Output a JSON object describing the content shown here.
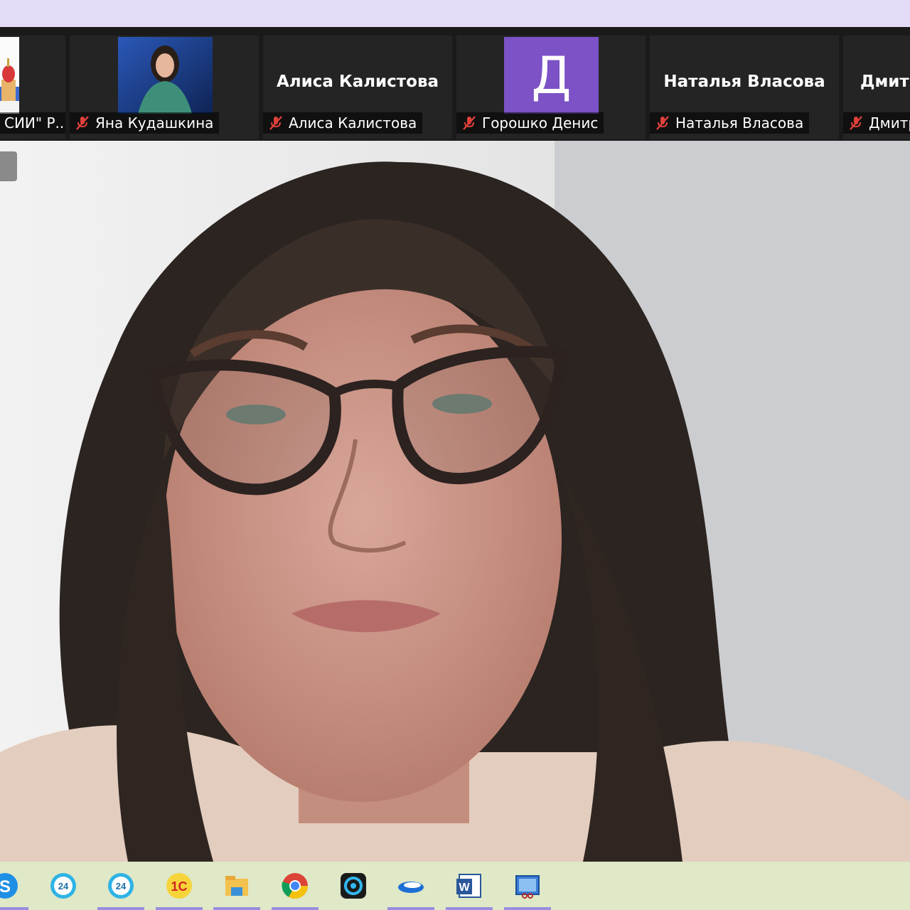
{
  "participants": [
    {
      "label": "СИИ\" Р..."
    },
    {
      "label": "Яна Кудашкина"
    },
    {
      "big": "Алиса Калистова",
      "label": "Алиса Калистова"
    },
    {
      "avatar_letter": "Д",
      "label": "Горошко Денис"
    },
    {
      "big": "Наталья Власова",
      "label": "Наталья Власова"
    },
    {
      "big": "Дмитр",
      "label": "Дмитр"
    }
  ],
  "colors": {
    "topbar": "#e4dcf7",
    "strip": "#1a1a1a",
    "avatar_purple": "#7c52c6",
    "taskbar": "#dfe8c7",
    "mute_red": "#e0413a"
  },
  "taskbar": {
    "items": [
      {
        "icon": "skype-icon"
      },
      {
        "icon": "bitrix24-icon"
      },
      {
        "icon": "bitrix24-icon"
      },
      {
        "icon": "1c-icon",
        "text": "1С"
      },
      {
        "icon": "file-explorer-icon"
      },
      {
        "icon": "chrome-icon"
      },
      {
        "icon": "camera-app-icon"
      },
      {
        "icon": "swirl-app-icon"
      },
      {
        "icon": "word-icon",
        "text": "W"
      },
      {
        "icon": "snipping-tool-icon"
      }
    ]
  }
}
